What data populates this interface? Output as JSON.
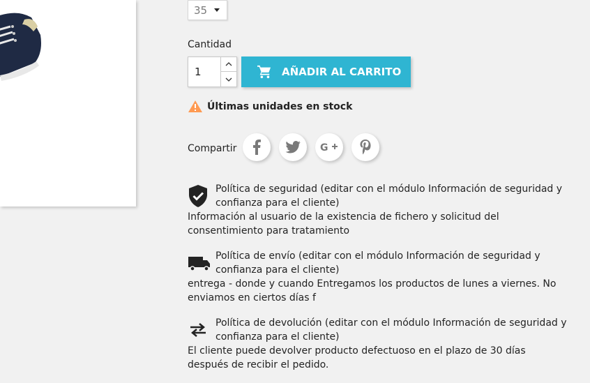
{
  "product": {
    "size_value": "35"
  },
  "quantity": {
    "label": "Cantidad",
    "value": "1"
  },
  "cart": {
    "button_label": "AÑADIR AL CARRITO"
  },
  "stock": {
    "message": "Últimas unidades en stock"
  },
  "share": {
    "label": "Compartir",
    "networks": [
      "facebook-icon",
      "twitter-icon",
      "google-plus-icon",
      "pinterest-icon"
    ]
  },
  "reassurance": [
    {
      "icon": "shield-check-icon",
      "title": "Política de seguridad (editar con el módulo Información de seguridad y confianza para el cliente)",
      "description": "Información al usuario de la existencia de fichero y solicitud del consentimiento para tratamiento"
    },
    {
      "icon": "truck-icon",
      "title": "Política de envío (editar con el módulo Información de seguridad y confianza para el cliente)",
      "description": "entrega - donde y cuando Entregamos los productos de lunes a viernes. No enviamos en ciertos días f"
    },
    {
      "icon": "swap-arrows-icon",
      "title": "Política de devolución (editar con el módulo Información de seguridad y confianza para el cliente)",
      "description": "El cliente puede devolver producto defectuoso en el plazo de 30 días después de recibir el pedido."
    }
  ],
  "colors": {
    "accent": "#2fb5d2",
    "warning": "#ff9a52",
    "background": "#f1f1f1"
  }
}
